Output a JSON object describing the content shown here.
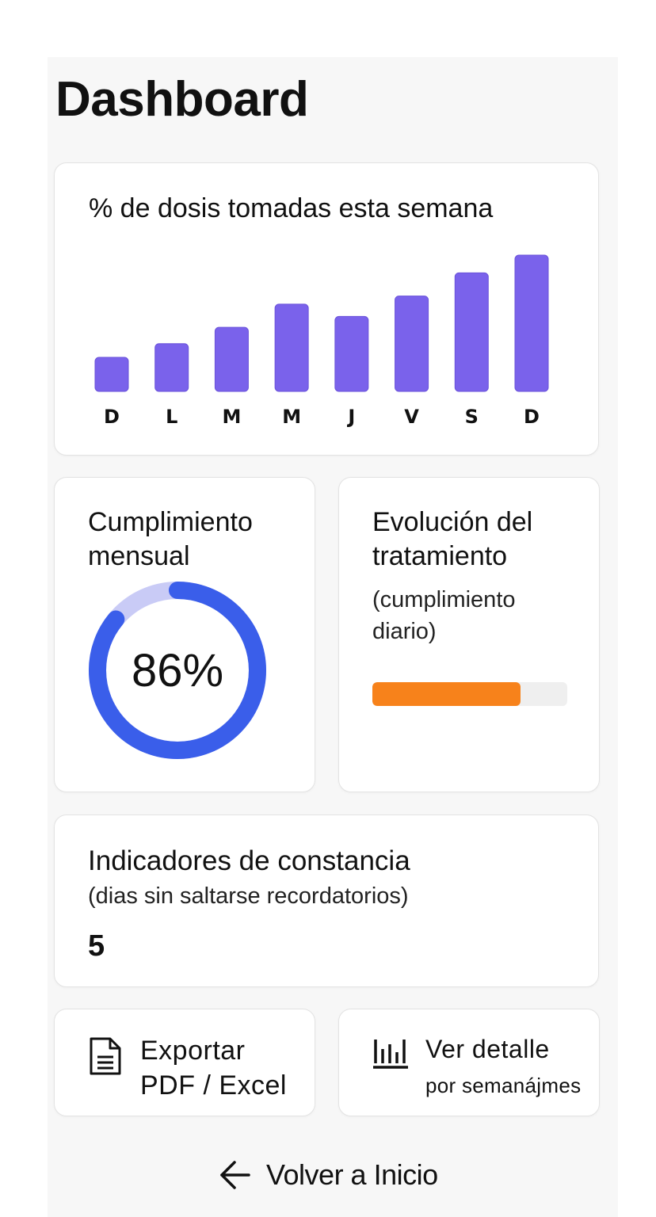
{
  "page": {
    "title": "Dashboard"
  },
  "weekly": {
    "title": "% de dosis tomadas esta semana",
    "chart_data": {
      "type": "bar",
      "title": "% de dosis tomadas esta semana",
      "categories": [
        "D",
        "L",
        "M",
        "M",
        "J",
        "V",
        "S",
        "D"
      ],
      "values": [
        25,
        35,
        47,
        64,
        55,
        70,
        87,
        100
      ],
      "ylim": [
        0,
        100
      ],
      "grid": false,
      "bar_color": "#7a62eb"
    }
  },
  "monthly": {
    "title_line1": "Cumplimiento",
    "title_line2": "mensual",
    "percent": 86,
    "value_text": "86%",
    "colors": {
      "fill": "#3a5eea",
      "track": "#c9cbf6"
    }
  },
  "evolution": {
    "title_line1": "Evolución del",
    "title_line2": "tratamiento",
    "sub_line1": "(cumplimiento",
    "sub_line2": "diario)",
    "progress": 0.76,
    "colors": {
      "fill": "#f7821b",
      "track": "#efefef"
    }
  },
  "streak": {
    "title": "Indicadores de constancia",
    "subtitle": "(dias sin saltarse recordatorios)",
    "value": "5"
  },
  "actions": {
    "export": {
      "icon": "document-icon",
      "line1": "Exportar",
      "line2": "PDF / Excel"
    },
    "detail": {
      "icon": "bar-chart-icon",
      "line1": "Ver detalle",
      "line2": "por semanájmes"
    }
  },
  "footer": {
    "back_icon": "arrow-left-icon",
    "back_label": "Volver a Inicio"
  }
}
